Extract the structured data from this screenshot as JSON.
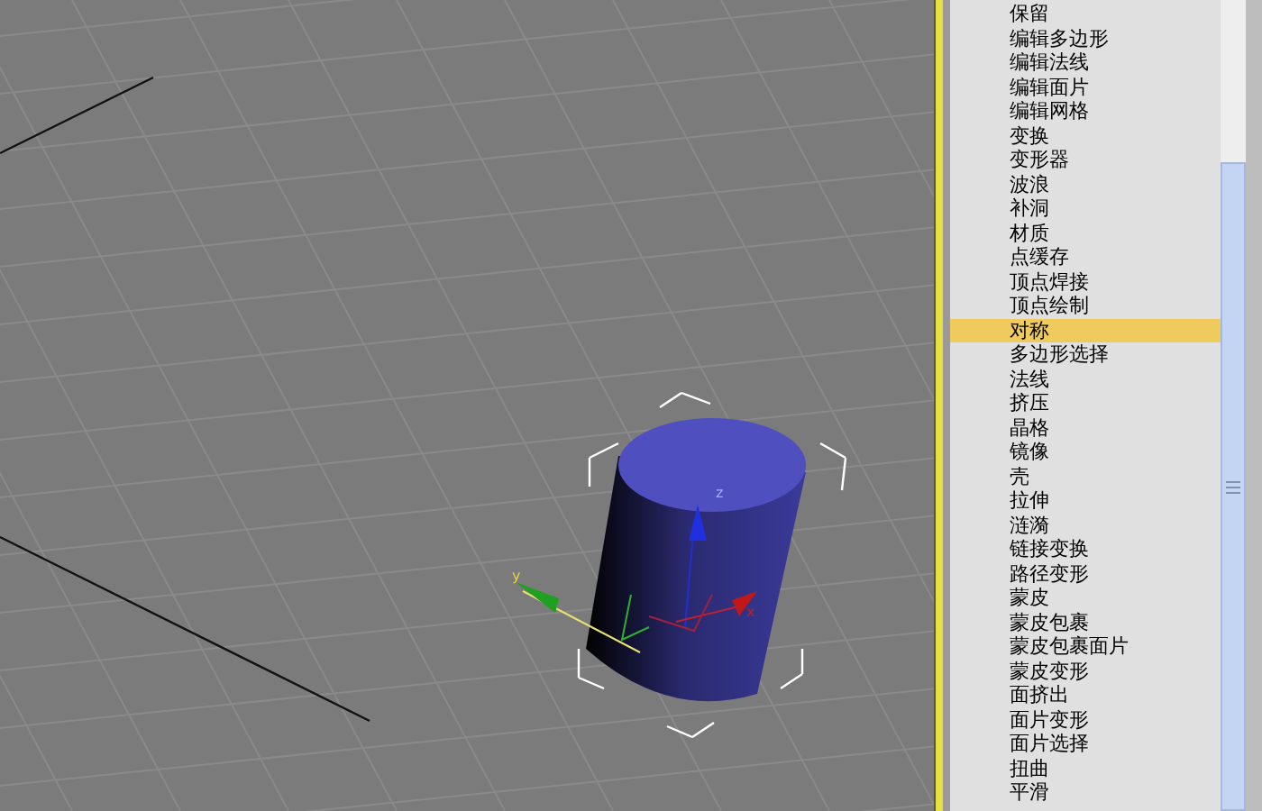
{
  "viewport": {
    "axis_labels": [
      {
        "kind": "x",
        "text": "x"
      },
      {
        "kind": "y",
        "text": "y"
      },
      {
        "kind": "z",
        "text": "z"
      }
    ]
  },
  "modifier_list": {
    "items": [
      {
        "label": "保留",
        "selected": false
      },
      {
        "label": "编辑多边形",
        "selected": false
      },
      {
        "label": "编辑法线",
        "selected": false
      },
      {
        "label": "编辑面片",
        "selected": false
      },
      {
        "label": "编辑网格",
        "selected": false
      },
      {
        "label": "变换",
        "selected": false
      },
      {
        "label": "变形器",
        "selected": false
      },
      {
        "label": "波浪",
        "selected": false
      },
      {
        "label": "补洞",
        "selected": false
      },
      {
        "label": "材质",
        "selected": false
      },
      {
        "label": "点缓存",
        "selected": false
      },
      {
        "label": "顶点焊接",
        "selected": false
      },
      {
        "label": "顶点绘制",
        "selected": false
      },
      {
        "label": "对称",
        "selected": true
      },
      {
        "label": "多边形选择",
        "selected": false
      },
      {
        "label": "法线",
        "selected": false
      },
      {
        "label": "挤压",
        "selected": false
      },
      {
        "label": "晶格",
        "selected": false
      },
      {
        "label": "镜像",
        "selected": false
      },
      {
        "label": "壳",
        "selected": false
      },
      {
        "label": "拉伸",
        "selected": false
      },
      {
        "label": "涟漪",
        "selected": false
      },
      {
        "label": "链接变换",
        "selected": false
      },
      {
        "label": "路径变形",
        "selected": false
      },
      {
        "label": "蒙皮",
        "selected": false
      },
      {
        "label": "蒙皮包裹",
        "selected": false
      },
      {
        "label": "蒙皮包裹面片",
        "selected": false
      },
      {
        "label": "蒙皮变形",
        "selected": false
      },
      {
        "label": "面挤出",
        "selected": false
      },
      {
        "label": "面片变形",
        "selected": false
      },
      {
        "label": "面片选择",
        "selected": false
      },
      {
        "label": "扭曲",
        "selected": false
      },
      {
        "label": "平滑",
        "selected": false
      }
    ]
  }
}
